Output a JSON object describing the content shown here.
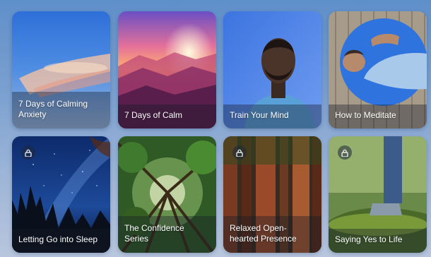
{
  "cards": [
    {
      "title": "7 Days of Calming\nAnxiety",
      "locked": false
    },
    {
      "title": "7 Days of Calm",
      "locked": false
    },
    {
      "title": "Train Your Mind",
      "locked": false
    },
    {
      "title": "How to Meditate",
      "locked": false
    },
    {
      "title": "Letting Go into Sleep",
      "locked": true
    },
    {
      "title": "The Confidence\nSeries",
      "locked": true
    },
    {
      "title": "Relaxed Open-\nhearted Presence",
      "locked": true
    },
    {
      "title": "Saying Yes to Life",
      "locked": true
    }
  ],
  "icons": {
    "lock": "lock-icon"
  }
}
